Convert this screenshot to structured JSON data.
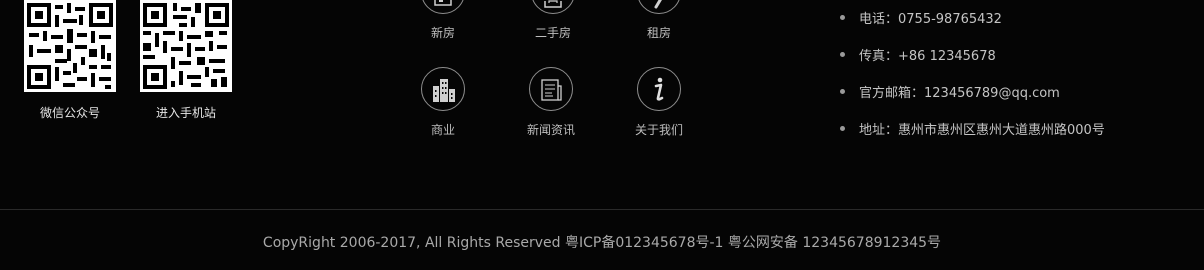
{
  "qr_codes": {
    "wechat_label": "微信公众号",
    "mobile_label": "进入手机站"
  },
  "nav": {
    "xinfang": "新房",
    "ershoufang": "二手房",
    "zufang": "租房",
    "shangye": "商业",
    "xinwen": "新闻资讯",
    "guanyu": "关于我们",
    "icons": [
      "house-icon",
      "key-icon",
      "rent-icon",
      "buildings-icon",
      "news-icon",
      "info-icon"
    ]
  },
  "contact": {
    "phone": "电话：0755-98765432",
    "fax": "传真：+86 12345678",
    "email": "官方邮箱：123456789@qq.com",
    "address": "地址：惠州市惠州区惠州大道惠州路000号"
  },
  "footer": {
    "copyright": "CopyRight 2006-2017, All Rights Reserved 粤ICP备012345678号-1 粤公网安备 12345678912345号"
  },
  "colors": {
    "background": "#050505",
    "text": "#b8b8b8",
    "divider": "#2a2a2a"
  }
}
